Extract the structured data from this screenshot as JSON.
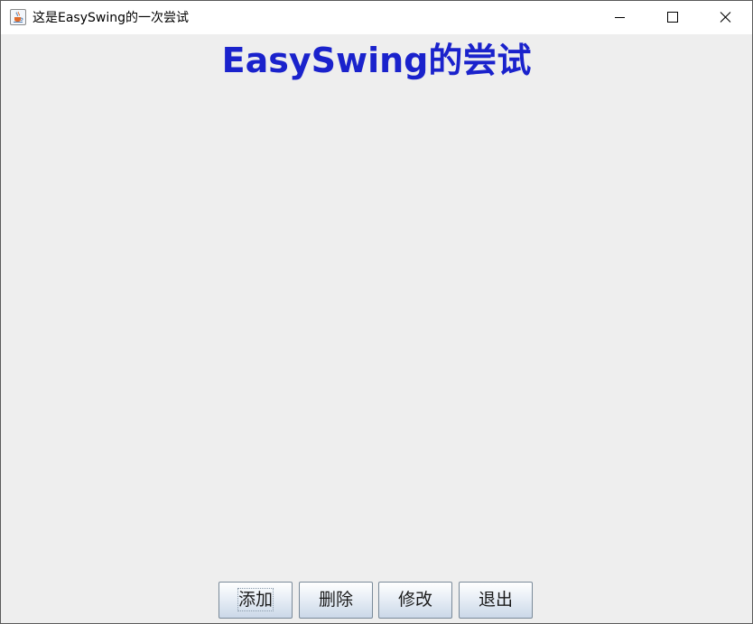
{
  "window": {
    "title": "这是EasySwing的一次尝试",
    "icon": "java-cup-icon",
    "controls": [
      "minimize-icon",
      "maximize-icon",
      "close-icon"
    ]
  },
  "main": {
    "heading": "EasySwing的尝试",
    "heading_color": "#1a22cc",
    "background_color": "#eeeeee"
  },
  "buttons": {
    "add_label": "添加",
    "delete_label": "删除",
    "modify_label": "修改",
    "exit_label": "退出",
    "focused": "添加"
  }
}
